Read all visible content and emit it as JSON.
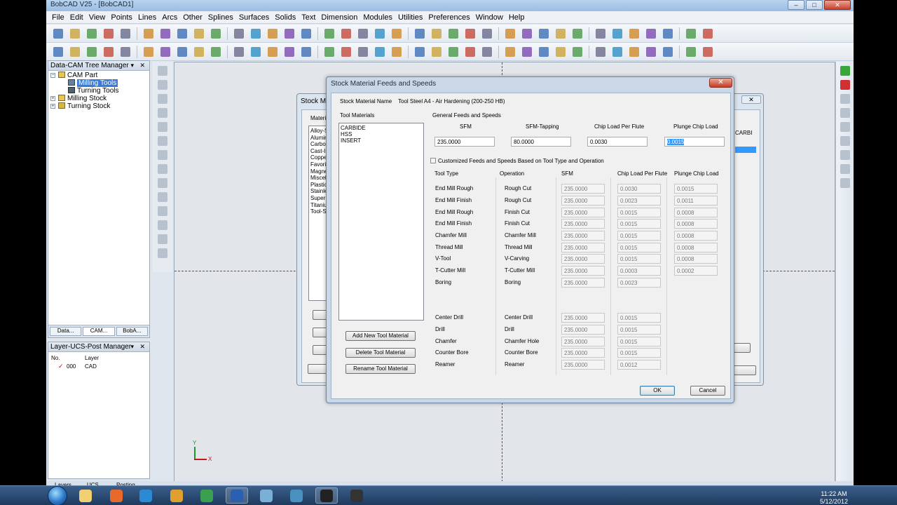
{
  "app": {
    "title": "BobCAD V25 - [BobCAD1]",
    "menu": [
      "File",
      "Edit",
      "View",
      "Points",
      "Lines",
      "Arcs",
      "Other",
      "Splines",
      "Surfaces",
      "Solids",
      "Text",
      "Dimension",
      "Modules",
      "Utilities",
      "Preferences",
      "Window",
      "Help"
    ],
    "window_controls": {
      "minimize": "–",
      "maximize": "□",
      "close": "✕"
    }
  },
  "tree_manager": {
    "title": "Data-CAM Tree Manager",
    "items": [
      {
        "label": "CAM Part"
      },
      {
        "label": "Milling Tools",
        "selected": true
      },
      {
        "label": "Turning Tools"
      },
      {
        "label": "Milling Stock"
      },
      {
        "label": "Turning Stock"
      }
    ],
    "tabs": [
      "Data...",
      "CAM...",
      "BobA..."
    ]
  },
  "layer_manager": {
    "title": "Layer-UCS-Post Manager",
    "columns": [
      "No.",
      "Layer"
    ],
    "rows": [
      {
        "no": "000",
        "layer": "CAD"
      }
    ]
  },
  "bg_dialog": {
    "title": "Stock Mat",
    "list_label": "Materia",
    "materials": [
      "Alloy-S",
      "Alumin",
      "Carbon",
      "Cast-Ir",
      "Copper",
      "Favorit",
      "Magnes",
      "Miscell",
      "Plastic",
      "Stainle",
      "Super-A",
      "Titaniu",
      "Tool-St"
    ],
    "right_label": "CARBI"
  },
  "dialog": {
    "title": "Stock Material Feeds and Speeds",
    "close": "✕",
    "stock_material_name_label": "Stock Material Name",
    "stock_material_name": "Tool Steel A4 - Air Hardening (200-250 HB)",
    "tool_materials_label": "Tool Materials",
    "tool_materials": [
      "CARBIDE",
      "HSS",
      "INSERT"
    ],
    "general_label": "General Feeds and Speeds",
    "general": {
      "sfm_label": "SFM",
      "sfm": "235.0000",
      "sfm_tapping_label": "SFM-Tapping",
      "sfm_tapping": "80.0000",
      "chip_load_label": "Chip Load Per Flute",
      "chip_load": "0.0030",
      "plunge_label": "Plunge Chip Load",
      "plunge": "0.0015"
    },
    "customized_label": "Customized Feeds and Speeds Based on Tool Type and Operation",
    "table_headers": [
      "Tool Type",
      "Operation",
      "SFM",
      "Chip Load Per Flute",
      "Plunge Chip Load"
    ],
    "rows": [
      {
        "tool": "End Mill Rough",
        "op": "Rough Cut",
        "sfm": "235.0000",
        "chip": "0.0030",
        "plunge": "0.0015"
      },
      {
        "tool": "End Mill Finish",
        "op": "Rough Cut",
        "sfm": "235.0000",
        "chip": "0.0023",
        "plunge": "0.0011"
      },
      {
        "tool": "End Mill Rough",
        "op": "Finish Cut",
        "sfm": "235.0000",
        "chip": "0.0015",
        "plunge": "0.0008"
      },
      {
        "tool": "End Mill Finish",
        "op": "Finish Cut",
        "sfm": "235.0000",
        "chip": "0.0015",
        "plunge": "0.0008"
      },
      {
        "tool": "Chamfer Mill",
        "op": "Chamfer Mill",
        "sfm": "235.0000",
        "chip": "0.0015",
        "plunge": "0.0008"
      },
      {
        "tool": "Thread Mill",
        "op": "Thread Mill",
        "sfm": "235.0000",
        "chip": "0.0015",
        "plunge": "0.0008"
      },
      {
        "tool": "V-Tool",
        "op": "V-Carving",
        "sfm": "235.0000",
        "chip": "0.0015",
        "plunge": "0.0008"
      },
      {
        "tool": "T-Cutter Mill",
        "op": "T-Cutter Mill",
        "sfm": "235.0000",
        "chip": "0.0003",
        "plunge": "0.0002"
      },
      {
        "tool": "Boring",
        "op": "Boring",
        "sfm": "235.0000",
        "chip": "0.0023",
        "plunge": ""
      },
      {
        "tool": "Center Drill",
        "op": "Center Drill",
        "sfm": "235.0000",
        "chip": "0.0015",
        "plunge": ""
      },
      {
        "tool": "Drill",
        "op": "Drill",
        "sfm": "235.0000",
        "chip": "0.0015",
        "plunge": ""
      },
      {
        "tool": "Chamfer",
        "op": "Chamfer Hole",
        "sfm": "235.0000",
        "chip": "0.0015",
        "plunge": ""
      },
      {
        "tool": "Counter Bore",
        "op": "Counter Bore",
        "sfm": "235.0000",
        "chip": "0.0015",
        "plunge": ""
      },
      {
        "tool": "Reamer",
        "op": "Reamer",
        "sfm": "235.0000",
        "chip": "0.0012",
        "plunge": ""
      }
    ],
    "add_button": "Add New Tool Material",
    "delete_button": "Delete Tool Material",
    "rename_button": "Rename Tool Material",
    "ok": "OK",
    "cancel": "Cancel"
  },
  "bottom_tabs": [
    "Layers",
    "UCS",
    "Posting"
  ],
  "axis": {
    "x": "X",
    "y": "Y"
  },
  "clock": {
    "time": "11:22 AM",
    "date": "5/12/2012"
  }
}
